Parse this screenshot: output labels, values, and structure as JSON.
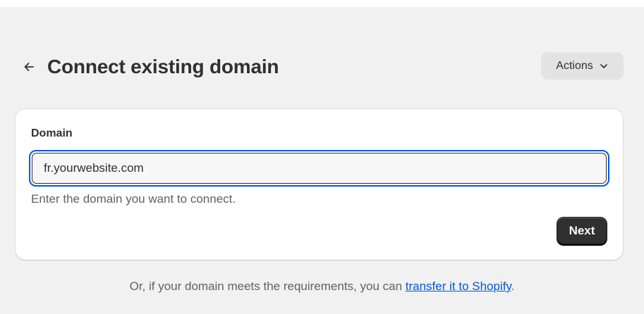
{
  "header": {
    "back_icon": "arrow-left-icon",
    "title": "Connect existing domain",
    "actions_label": "Actions",
    "actions_icon": "chevron-down-icon"
  },
  "form": {
    "label": "Domain",
    "input_value": "fr.yourwebsite.com",
    "help_text": "Enter the domain you want to connect.",
    "next_label": "Next"
  },
  "footer": {
    "prefix": "Or, if your domain meets the requirements, you can ",
    "link_text": "transfer it to Shopify",
    "suffix": "."
  },
  "colors": {
    "background": "#f1f1f1",
    "focus_ring": "#005bd3",
    "primary_button": "#303030",
    "link": "#005bd3"
  }
}
